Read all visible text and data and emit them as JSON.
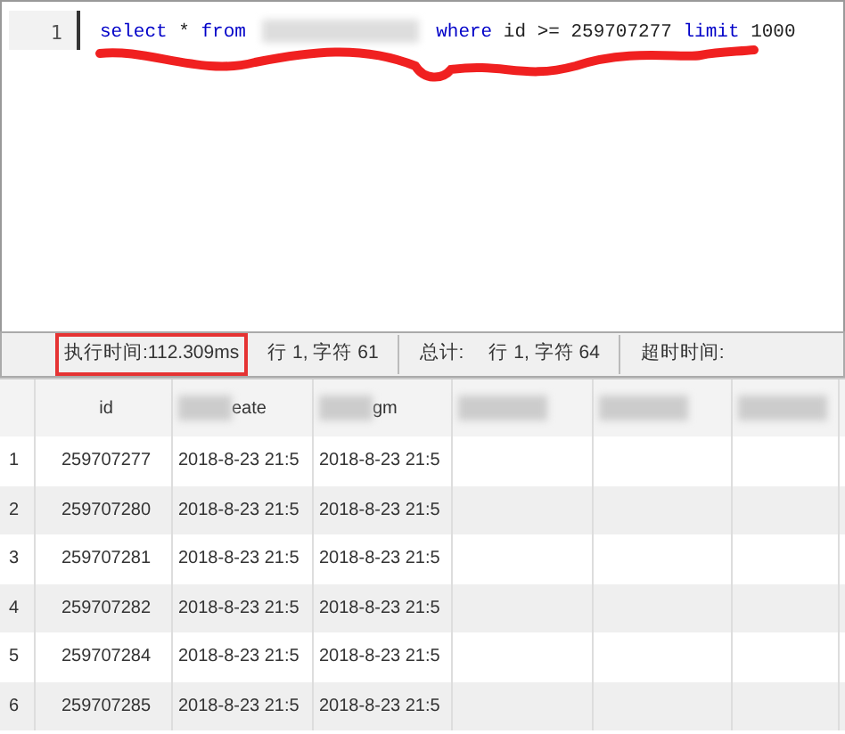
{
  "editor": {
    "line_number": "1",
    "tokens": [
      {
        "kind": "keyword",
        "text": "select"
      },
      {
        "kind": "plain",
        "text": "*"
      },
      {
        "kind": "keyword",
        "text": "from"
      },
      {
        "kind": "redacted"
      },
      {
        "kind": "keyword",
        "text": "where"
      },
      {
        "kind": "plain",
        "text": "id >= 259707277"
      },
      {
        "kind": "keyword",
        "text": "limit"
      },
      {
        "kind": "plain",
        "text": "1000"
      }
    ],
    "underlined": true
  },
  "status_bar": [
    {
      "text": "执行时间:112.309ms",
      "highlighted": true,
      "divider": false
    },
    {
      "text": "行 1, 字符 61",
      "highlighted": false,
      "divider": true
    },
    {
      "text": "总计:",
      "highlighted": false,
      "divider": false
    },
    {
      "text": "行 1, 字符 64",
      "highlighted": false,
      "divider": true
    },
    {
      "text": "超时时间:",
      "highlighted": false,
      "divider": false
    }
  ],
  "table": {
    "columns": [
      {
        "label": "id",
        "redacted": false
      },
      {
        "label": "eate",
        "redacted": true
      },
      {
        "label": "gm",
        "redacted": true
      },
      {
        "redacted": true
      },
      {
        "redacted": true
      },
      {
        "redacted": true
      }
    ],
    "rows": [
      {
        "number": "1",
        "cells": [
          "259707277",
          "2018-8-23 21:5",
          "2018-8-23 21:5"
        ]
      },
      {
        "number": "2",
        "cells": [
          "259707280",
          "2018-8-23 21:5",
          "2018-8-23 21:5"
        ]
      },
      {
        "number": "3",
        "cells": [
          "259707281",
          "2018-8-23 21:5",
          "2018-8-23 21:5"
        ]
      },
      {
        "number": "4",
        "cells": [
          "259707282",
          "2018-8-23 21:5",
          "2018-8-23 21:5"
        ]
      },
      {
        "number": "5",
        "cells": [
          "259707284",
          "2018-8-23 21:5",
          "2018-8-23 21:5"
        ]
      },
      {
        "number": "6",
        "cells": [
          "259707285",
          "2018-8-23 21:5",
          "2018-8-23 21:5"
        ]
      }
    ]
  }
}
